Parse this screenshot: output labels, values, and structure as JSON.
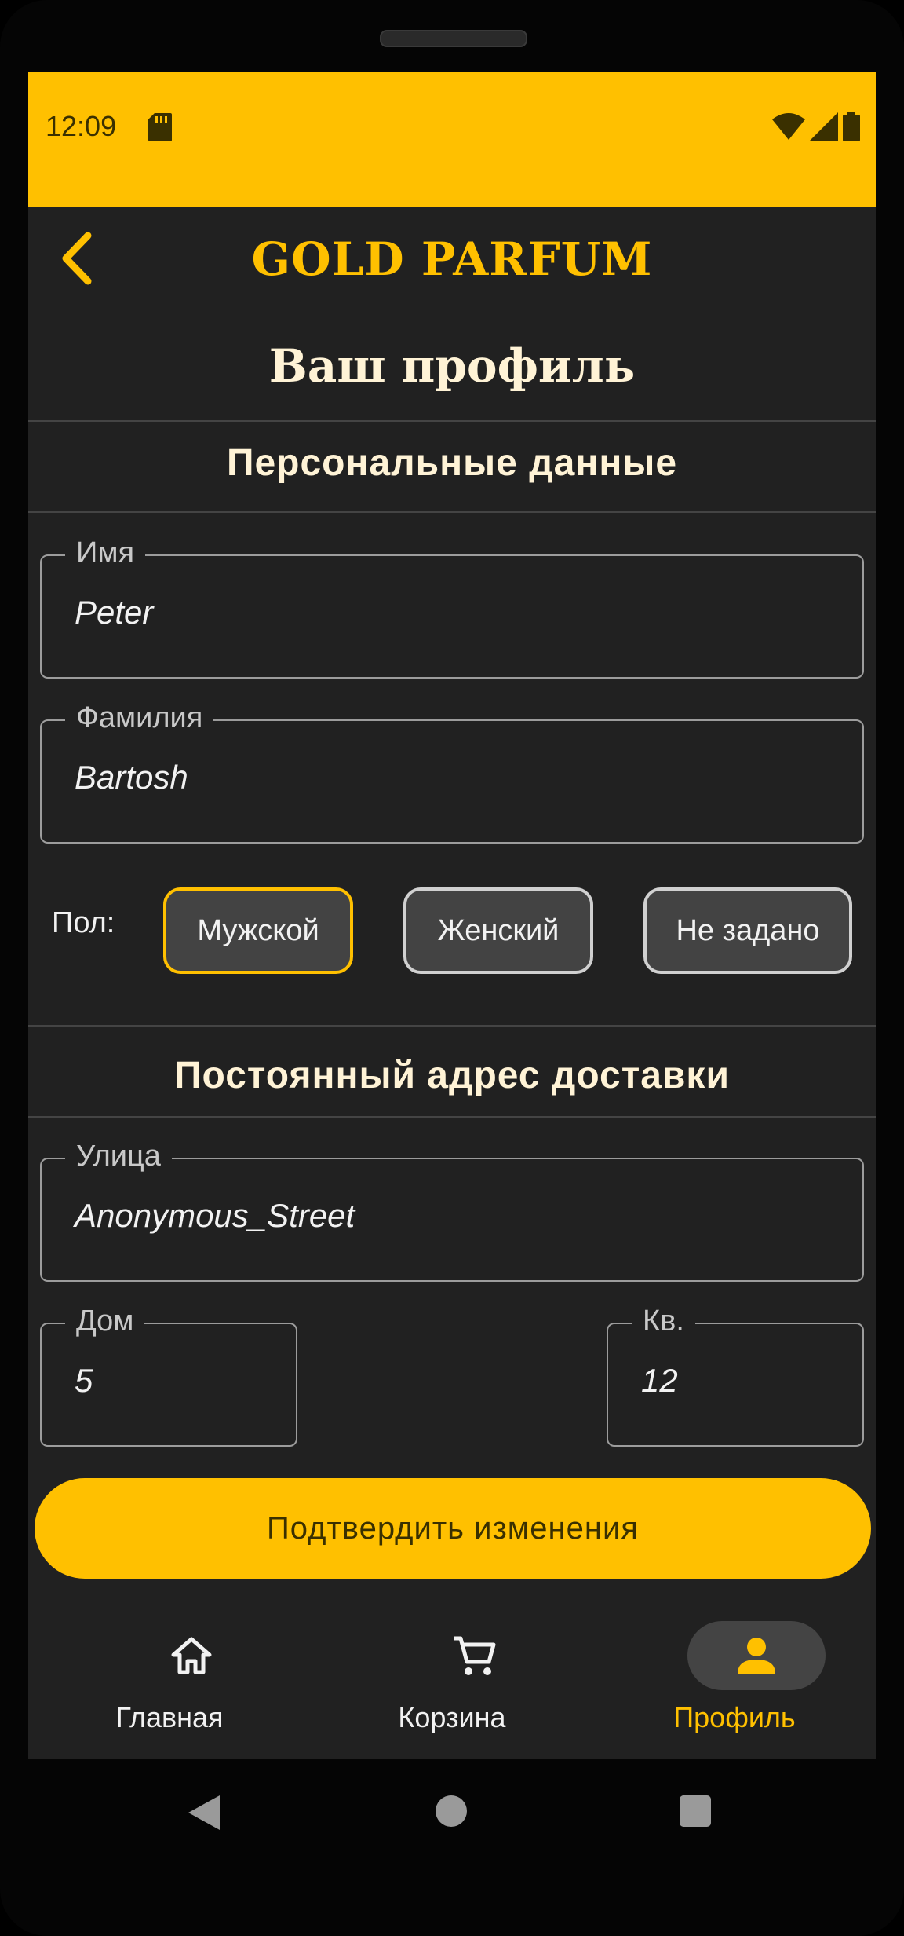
{
  "status_bar": {
    "time": "12:09"
  },
  "app_bar": {
    "brand": "GOLD PARFUM"
  },
  "page": {
    "title": "Ваш профиль"
  },
  "personal": {
    "section_title": "Персональные данные",
    "first_name": {
      "label": "Имя",
      "value": "Peter"
    },
    "last_name": {
      "label": "Фамилия",
      "value": "Bartosh"
    },
    "gender": {
      "label": "Пол:",
      "options": [
        "Мужской",
        "Женский",
        "Не задано"
      ],
      "selected": "Мужской"
    }
  },
  "address": {
    "section_title": "Постоянный адрес доставки",
    "street": {
      "label": "Улица",
      "value": "Anonymous_Street"
    },
    "house": {
      "label": "Дом",
      "value": "5"
    },
    "apartment": {
      "label": "Кв.",
      "value": "12"
    }
  },
  "confirm_button": {
    "label": "Подтвердить изменения"
  },
  "bottom_nav": {
    "items": [
      {
        "label": "Главная",
        "icon": "home-icon"
      },
      {
        "label": "Корзина",
        "icon": "cart-icon"
      },
      {
        "label": "Профиль",
        "icon": "person-icon"
      }
    ],
    "active": "Профиль"
  },
  "colors": {
    "accent": "#FFC000",
    "background": "#212121",
    "text": "#FFF3D6"
  }
}
